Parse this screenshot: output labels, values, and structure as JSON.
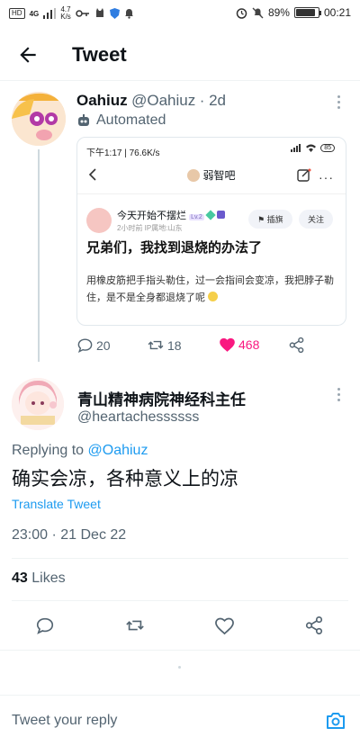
{
  "status_bar": {
    "hd": "HD",
    "network": "4G",
    "speed_value": "4.7",
    "speed_unit": "K/s",
    "battery_percent": "89%",
    "battery_level": 0.89,
    "time": "00:21"
  },
  "header": {
    "title": "Tweet"
  },
  "tweet1": {
    "name": "Oahiuz",
    "handle": "@Oahiuz",
    "age": "· 2d",
    "automated": "Automated",
    "embed": {
      "status_time": "下午1:17 | 76.6K/s",
      "status_right": "85",
      "forum_title": "弱智吧",
      "username": "今天开始不摆烂",
      "level": "Lv.2",
      "subline": "2小时前  IP属地:山东",
      "btn_insert": "插旗",
      "btn_follow": "关注",
      "headline": "兄弟们，我找到退烧的办法了",
      "body": "用橡皮筋把手指头勒住，过一会指间会变凉，我把脖子勒住，是不是全身都退烧了呢"
    },
    "replies": "20",
    "retweets": "18",
    "likes": "468"
  },
  "tweet2": {
    "name": "青山精神病院神经科主任",
    "handle": "@heartachessssss",
    "replying_prefix": "Replying to",
    "replying_handle": "@Oahiuz",
    "text": "确实会凉，各种意义上的凉",
    "translate": "Translate Tweet",
    "timestamp": "23:00 · 21 Dec 22",
    "likes_count": "43",
    "likes_label": "Likes"
  },
  "reply_bar": {
    "placeholder": "Tweet your reply"
  },
  "colors": {
    "accent": "#1d9bf0",
    "like": "#f91880",
    "muted": "#536471"
  }
}
